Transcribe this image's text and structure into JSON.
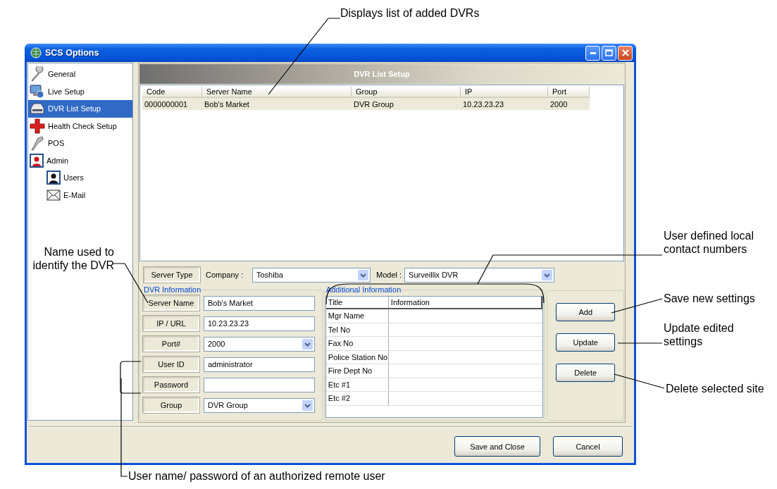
{
  "window": {
    "title": "SCS Options"
  },
  "sidebar": {
    "items": [
      {
        "label": "General",
        "selected": false
      },
      {
        "label": "Live Setup",
        "selected": false
      },
      {
        "label": "DVR List Setup",
        "selected": true
      },
      {
        "label": "Health Check Setup",
        "selected": false
      },
      {
        "label": "POS",
        "selected": false
      },
      {
        "label": "Admin",
        "selected": false,
        "children": [
          {
            "label": "Users",
            "selected": false
          },
          {
            "label": "E-Mail",
            "selected": false
          }
        ]
      }
    ]
  },
  "panel": {
    "title": "DVR List Setup"
  },
  "dvr_list": {
    "columns": [
      "Code",
      "Server Name",
      "Group",
      "IP",
      "Port"
    ],
    "rows": [
      {
        "cells": [
          "0000000001",
          "Bob's Market",
          "DVR Group",
          "10.23.23.23",
          "2000"
        ],
        "selected": true
      }
    ]
  },
  "server_type": {
    "label": "Server Type",
    "company_label": "Company :",
    "company": "Toshiba",
    "model_label": "Model :",
    "model": "Surveillix DVR"
  },
  "dvr_information": {
    "title": "DVR Information",
    "fields": [
      {
        "label": "Server Name",
        "value": "Bob's Market",
        "kind": "text"
      },
      {
        "label": "IP / URL",
        "value": "10.23.23.23",
        "kind": "text"
      },
      {
        "label": "Port#",
        "value": "2000",
        "kind": "dropdown"
      },
      {
        "label": "User ID",
        "value": "administrator",
        "kind": "text"
      },
      {
        "label": "Password",
        "kind": "text"
      },
      {
        "label": "Group",
        "value": "DVR Group",
        "kind": "dropdown"
      }
    ]
  },
  "additional_information": {
    "title": "Additional Information",
    "columns": [
      "Title",
      "Information"
    ],
    "rows": [
      {
        "title": "Mgr Name"
      },
      {
        "title": "Tel No"
      },
      {
        "title": "Fax No"
      },
      {
        "title": "Police Station No"
      },
      {
        "title": "Fire Dept No"
      },
      {
        "title": "Etc #1"
      },
      {
        "title": "Etc #2"
      }
    ]
  },
  "actions": [
    "Add",
    "Update",
    "Delete"
  ],
  "footer_buttons": [
    "Save and Close",
    "Cancel"
  ],
  "callouts": [
    {
      "text": "Displays list of added DVRs"
    },
    {
      "text": "Name used to identify the DVR"
    },
    {
      "text": "User defined local contact numbers"
    },
    {
      "text": "Save new settings"
    },
    {
      "text": "Update edited settings"
    },
    {
      "text": "Delete selected site"
    },
    {
      "text": "User name/ password of an authorized remote user"
    }
  ]
}
